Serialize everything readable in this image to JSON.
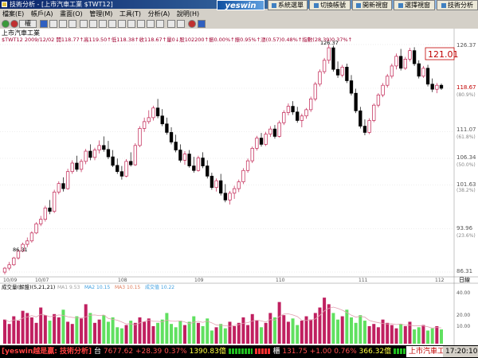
{
  "window": {
    "title": "技術分析 - [上市汽車工業 $TWT12]"
  },
  "menu": [
    "檔案(E)",
    "帳戶(A)",
    "畫面(O)",
    "管理(M)",
    "工具(T)",
    "分析(A)",
    "說明(H)"
  ],
  "toolbar": {
    "combo_label": "權"
  },
  "logo_text": "yeswin",
  "top_buttons": [
    "系統選單",
    "切換帳號",
    "開新視窗",
    "選擇視窗",
    "技術分析"
  ],
  "chart": {
    "name": "上市汽車工業",
    "info_line": "$TWT12 2009/12/02 開118.77↑高119.50↑低118.38↑收118.67↑量0↓股102200↑振0.00%↑振0.95%↑漲(0.57)0.48%↑指數(28.39)0.37%↑",
    "price_axis": {
      "labels": [
        "126.37",
        "118.67",
        "111.07",
        "106.34",
        "101.63",
        "93.96",
        "86.31"
      ],
      "pct_labels": [
        "(80.9%)",
        "(61.8%)",
        "(50.0%)",
        "(38.2%)",
        "(23.6%)"
      ],
      "current": "118.67",
      "max_marker": "126.37",
      "min_marker": "86.31"
    },
    "price_box": "121.01",
    "month_labels": [
      "10/09",
      "10/07",
      "108",
      "109",
      "110",
      "111",
      "112",
      "日線"
    ],
    "volume": {
      "title": "成交量(解盤)(5,21,21)",
      "ma_labels": [
        "MA1 9.53",
        "MA2 10.15",
        "MA3 10.15",
        "成交值 10.22"
      ],
      "axis": [
        "40.00",
        "20.00",
        "10.00"
      ],
      "colors": {
        "up": "#c02060",
        "down": "#60e060"
      }
    }
  },
  "status": {
    "brand": "[yeswin越是贏: 技術分析]",
    "tai": "台",
    "tai_value": "7677.62",
    "tai_change": "+28.39",
    "tai_pct": "0.37%",
    "tai_volume": "1390.83億",
    "gui": "櫃",
    "gui_value": "131.75",
    "gui_change": "+1.00",
    "gui_pct": "0.76%",
    "gui_volume": "366.32億",
    "tab": "上市汽車工",
    "time": "17:20:10"
  },
  "colors": {
    "up": "#c02050",
    "down": "#000000",
    "ma_pink": "#e0a0b0"
  },
  "chart_data": {
    "type": "candlestick",
    "title": "上市汽車工業",
    "ylim": [
      86.31,
      126.37
    ],
    "ohlc": [
      [
        86.3,
        87.2,
        85.9,
        87.0
      ],
      [
        87.0,
        88.1,
        86.6,
        87.6
      ],
      [
        87.6,
        89.0,
        87.4,
        88.8
      ],
      [
        88.8,
        90.3,
        88.5,
        90.0
      ],
      [
        90.0,
        91.5,
        89.8,
        91.2
      ],
      [
        91.2,
        92.4,
        90.7,
        91.8
      ],
      [
        91.8,
        93.5,
        91.5,
        93.2
      ],
      [
        93.2,
        95.1,
        93.0,
        94.8
      ],
      [
        94.8,
        96.2,
        94.4,
        95.6
      ],
      [
        95.6,
        98.0,
        95.2,
        97.6
      ],
      [
        97.6,
        99.0,
        96.5,
        97.0
      ],
      [
        97.0,
        100.8,
        96.7,
        100.4
      ],
      [
        100.4,
        102.3,
        100.0,
        101.9
      ],
      [
        101.9,
        103.0,
        100.5,
        101.0
      ],
      [
        101.0,
        104.5,
        100.8,
        104.0
      ],
      [
        104.0,
        106.0,
        103.6,
        105.5
      ],
      [
        105.5,
        106.8,
        104.0,
        104.4
      ],
      [
        104.4,
        106.2,
        103.9,
        105.8
      ],
      [
        105.8,
        108.0,
        105.3,
        107.6
      ],
      [
        107.6,
        108.8,
        106.0,
        106.5
      ],
      [
        106.5,
        108.2,
        106.0,
        107.8
      ],
      [
        107.8,
        109.5,
        107.2,
        108.6
      ],
      [
        108.6,
        110.2,
        107.5,
        107.9
      ],
      [
        107.9,
        109.4,
        106.2,
        106.6
      ],
      [
        106.6,
        107.8,
        104.8,
        105.1
      ],
      [
        105.1,
        106.3,
        103.6,
        104.0
      ],
      [
        104.0,
        105.0,
        102.6,
        103.2
      ],
      [
        103.2,
        106.2,
        103.0,
        105.8
      ],
      [
        105.8,
        107.4,
        104.9,
        105.2
      ],
      [
        105.2,
        109.0,
        105.0,
        108.6
      ],
      [
        108.6,
        112.0,
        108.3,
        111.6
      ],
      [
        111.6,
        113.5,
        111.0,
        112.8
      ],
      [
        112.8,
        114.8,
        112.4,
        113.5
      ],
      [
        113.5,
        115.6,
        113.0,
        115.2
      ],
      [
        115.2,
        116.8,
        113.4,
        113.8
      ],
      [
        113.8,
        115.0,
        112.0,
        112.4
      ],
      [
        112.4,
        113.5,
        110.5,
        110.9
      ],
      [
        110.9,
        111.8,
        108.8,
        109.2
      ],
      [
        109.2,
        110.5,
        107.4,
        107.8
      ],
      [
        107.8,
        108.8,
        105.6,
        106.0
      ],
      [
        106.0,
        107.6,
        105.2,
        107.1
      ],
      [
        107.1,
        107.8,
        104.7,
        105.0
      ],
      [
        105.0,
        106.6,
        103.8,
        104.2
      ],
      [
        104.2,
        106.8,
        104.0,
        106.4
      ],
      [
        106.4,
        107.4,
        104.6,
        105.0
      ],
      [
        105.0,
        106.0,
        102.8,
        103.2
      ],
      [
        103.2,
        103.8,
        100.8,
        101.2
      ],
      [
        101.2,
        102.8,
        100.5,
        102.4
      ],
      [
        102.4,
        103.6,
        99.8,
        100.2
      ],
      [
        100.2,
        101.8,
        98.6,
        99.0
      ],
      [
        99.0,
        100.6,
        98.2,
        100.2
      ],
      [
        100.2,
        101.5,
        99.2,
        101.0
      ],
      [
        101.0,
        102.6,
        100.4,
        102.2
      ],
      [
        102.2,
        104.6,
        101.8,
        104.2
      ],
      [
        104.2,
        106.3,
        103.8,
        105.9
      ],
      [
        105.9,
        108.4,
        105.5,
        108.1
      ],
      [
        108.1,
        110.3,
        107.7,
        109.9
      ],
      [
        109.9,
        110.8,
        108.4,
        108.8
      ],
      [
        108.8,
        111.0,
        108.5,
        110.6
      ],
      [
        110.6,
        112.0,
        110.1,
        111.5
      ],
      [
        111.5,
        112.2,
        109.8,
        110.2
      ],
      [
        110.2,
        113.0,
        110.0,
        112.6
      ],
      [
        112.6,
        114.8,
        112.2,
        114.4
      ],
      [
        114.4,
        116.0,
        113.9,
        115.5
      ],
      [
        115.5,
        116.4,
        114.0,
        114.5
      ],
      [
        114.5,
        115.4,
        112.6,
        113.0
      ],
      [
        113.0,
        114.2,
        111.8,
        113.8
      ],
      [
        113.8,
        115.2,
        113.3,
        114.9
      ],
      [
        114.9,
        117.2,
        114.5,
        116.8
      ],
      [
        116.8,
        119.8,
        116.4,
        119.4
      ],
      [
        119.4,
        122.0,
        119.0,
        121.6
      ],
      [
        121.6,
        124.0,
        121.2,
        123.6
      ],
      [
        123.6,
        126.37,
        123.0,
        125.8
      ],
      [
        125.8,
        126.2,
        121.6,
        122.0
      ],
      [
        122.0,
        123.4,
        120.5,
        121.0
      ],
      [
        121.0,
        122.8,
        120.6,
        122.4
      ],
      [
        122.4,
        123.0,
        119.6,
        120.0
      ],
      [
        120.0,
        121.0,
        117.4,
        117.8
      ],
      [
        117.8,
        118.6,
        114.3,
        114.7
      ],
      [
        114.7,
        115.4,
        111.6,
        112.0
      ],
      [
        112.0,
        113.2,
        110.4,
        110.9
      ],
      [
        110.9,
        113.4,
        110.6,
        113.0
      ],
      [
        113.0,
        116.0,
        112.7,
        115.7
      ],
      [
        115.7,
        117.8,
        115.3,
        117.5
      ],
      [
        117.5,
        119.6,
        117.1,
        119.2
      ],
      [
        119.2,
        121.2,
        118.8,
        120.8
      ],
      [
        120.8,
        123.0,
        120.4,
        122.6
      ],
      [
        122.6,
        124.8,
        122.0,
        124.3
      ],
      [
        124.3,
        125.6,
        121.8,
        122.2
      ],
      [
        122.2,
        124.2,
        121.9,
        123.8
      ],
      [
        123.8,
        125.8,
        123.4,
        125.3
      ],
      [
        125.3,
        125.9,
        122.6,
        123.0
      ],
      [
        123.0,
        123.6,
        120.4,
        120.8
      ],
      [
        120.8,
        122.6,
        120.5,
        122.2
      ],
      [
        122.2,
        122.8,
        119.0,
        119.4
      ],
      [
        119.4,
        120.4,
        118.0,
        118.5
      ],
      [
        118.5,
        119.6,
        117.8,
        119.2
      ],
      [
        119.2,
        119.5,
        118.38,
        118.67
      ]
    ],
    "volume": [
      22,
      18,
      25,
      21,
      30,
      28,
      24,
      19,
      33,
      26,
      21,
      27,
      24,
      31,
      20,
      18,
      25,
      23,
      36,
      28,
      19,
      22,
      26,
      20,
      24,
      15,
      14,
      17,
      21,
      19,
      24,
      20,
      23,
      16,
      19,
      22,
      28,
      18,
      15,
      21,
      17,
      20,
      25,
      19,
      16,
      23,
      12,
      15,
      18,
      14,
      20,
      16,
      19,
      24,
      17,
      27,
      21,
      15,
      19,
      28,
      24,
      38,
      26,
      20,
      23,
      17,
      21,
      25,
      22,
      28,
      33,
      42,
      36,
      28,
      22,
      25,
      31,
      24,
      19,
      26,
      21,
      16,
      18,
      15,
      22,
      19,
      17,
      14,
      18,
      16,
      20,
      13,
      15,
      17,
      12,
      14,
      16,
      13
    ]
  }
}
